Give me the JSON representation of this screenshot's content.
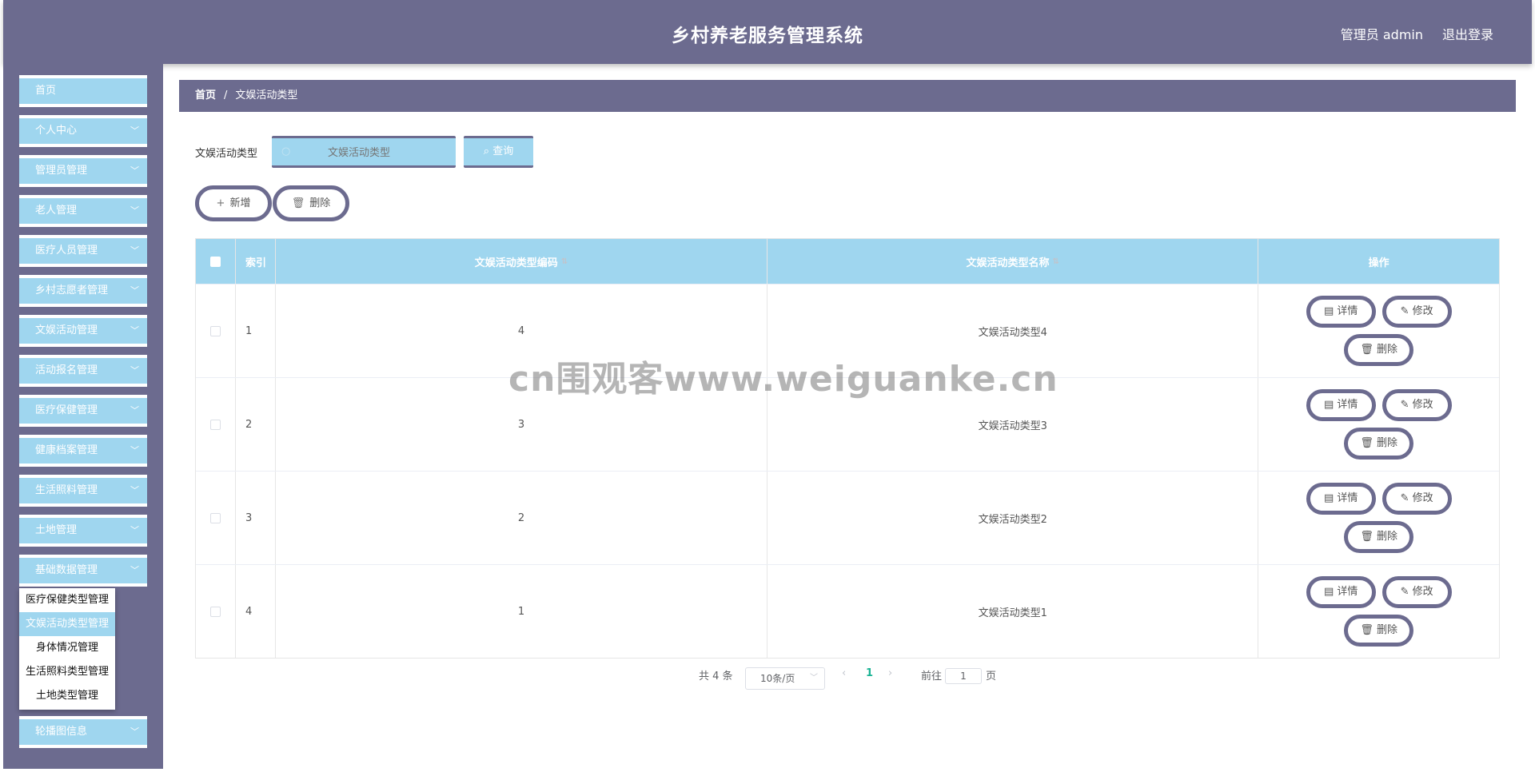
{
  "header": {
    "title": "乡村养老服务管理系统",
    "user": "管理员 admin",
    "logout": "退出登录"
  },
  "sidebar": {
    "items": [
      {
        "label": "首页",
        "has_arrow": false
      },
      {
        "label": "个人中心",
        "has_arrow": true
      },
      {
        "label": "管理员管理",
        "has_arrow": true
      },
      {
        "label": "老人管理",
        "has_arrow": true
      },
      {
        "label": "医疗人员管理",
        "has_arrow": true
      },
      {
        "label": "乡村志愿者管理",
        "has_arrow": true
      },
      {
        "label": "文娱活动管理",
        "has_arrow": true
      },
      {
        "label": "活动报名管理",
        "has_arrow": true
      },
      {
        "label": "医疗保健管理",
        "has_arrow": true
      },
      {
        "label": "健康档案管理",
        "has_arrow": true
      },
      {
        "label": "生活照料管理",
        "has_arrow": true
      },
      {
        "label": "土地管理",
        "has_arrow": true
      },
      {
        "label": "基础数据管理",
        "has_arrow": true
      },
      {
        "label": "轮播图信息",
        "has_arrow": true
      }
    ],
    "submenu": [
      {
        "label": "医疗保健类型管理",
        "active": false
      },
      {
        "label": "文娱活动类型管理",
        "active": true
      },
      {
        "label": "身体情况管理",
        "active": false
      },
      {
        "label": "生活照料类型管理",
        "active": false
      },
      {
        "label": "土地类型管理",
        "active": false
      }
    ]
  },
  "breadcrumb": {
    "home": "首页",
    "separator": "/",
    "current": "文娱活动类型"
  },
  "search": {
    "label": "文娱活动类型",
    "placeholder": "文娱活动类型",
    "button": "查询"
  },
  "actions": {
    "add": "新增",
    "delete": "删除"
  },
  "table": {
    "headers": {
      "index": "索引",
      "code": "文娱活动类型编码",
      "name": "文娱活动类型名称",
      "ops": "操作"
    },
    "rows": [
      {
        "index": "1",
        "code": "4",
        "name": "文娱活动类型4"
      },
      {
        "index": "2",
        "code": "3",
        "name": "文娱活动类型3"
      },
      {
        "index": "3",
        "code": "2",
        "name": "文娱活动类型2"
      },
      {
        "index": "4",
        "code": "1",
        "name": "文娱活动类型1"
      }
    ],
    "row_actions": {
      "detail": "详情",
      "edit": "修改",
      "delete": "删除"
    }
  },
  "pagination": {
    "total": "共 4 条",
    "page_size": "10条/页",
    "current_page": "1",
    "goto_prefix": "前往",
    "goto_value": "1",
    "goto_suffix": "页"
  },
  "watermark": "cn围观客www.weiguanke.cn",
  "colors": {
    "header": "#6c6b8f",
    "accent": "#9fd6ef",
    "active_page": "#1ab394"
  }
}
